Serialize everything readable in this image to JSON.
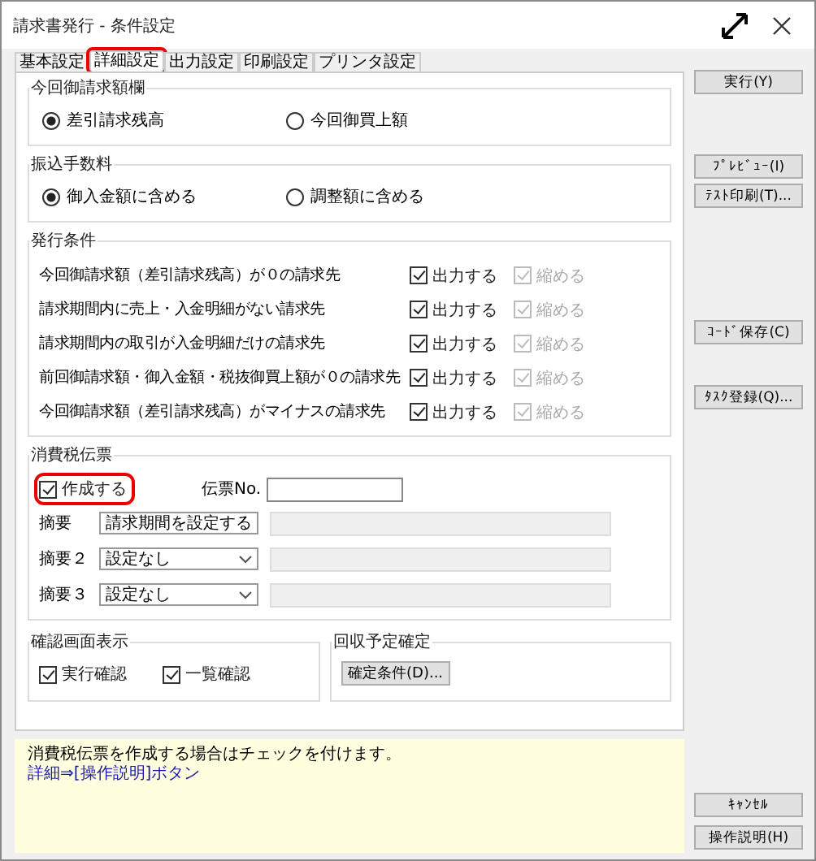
{
  "window": {
    "title": "請求書発行 - 条件設定"
  },
  "tabs": [
    {
      "label": "基本設定",
      "selected": false,
      "highlighted": false
    },
    {
      "label": "詳細設定",
      "selected": true,
      "highlighted": true
    },
    {
      "label": "出力設定",
      "selected": false,
      "highlighted": false
    },
    {
      "label": "印刷設定",
      "selected": false,
      "highlighted": false
    },
    {
      "label": "プリンタ設定",
      "selected": false,
      "highlighted": false
    }
  ],
  "billing_amount": {
    "title": "今回御請求額欄",
    "options": [
      {
        "label": "差引請求残高",
        "selected": true
      },
      {
        "label": "今回御買上額",
        "selected": false
      }
    ]
  },
  "transfer_fee": {
    "title": "振込手数料",
    "options": [
      {
        "label": "御入金額に含める",
        "selected": true
      },
      {
        "label": "調整額に含める",
        "selected": false
      }
    ]
  },
  "issue_conditions": {
    "title": "発行条件",
    "rows": [
      {
        "label": "今回御請求額（差引請求残高）が０の請求先",
        "output": {
          "label": "出力する",
          "checked": true,
          "disabled": false
        },
        "shrink": {
          "label": "縮める",
          "checked": true,
          "disabled": true
        }
      },
      {
        "label": "請求期間内に売上・入金明細がない請求先",
        "output": {
          "label": "出力する",
          "checked": true,
          "disabled": false
        },
        "shrink": {
          "label": "縮める",
          "checked": true,
          "disabled": true
        }
      },
      {
        "label": "請求期間内の取引が入金明細だけの請求先",
        "output": {
          "label": "出力する",
          "checked": true,
          "disabled": false
        },
        "shrink": {
          "label": "縮める",
          "checked": true,
          "disabled": true
        }
      },
      {
        "label": "前回御請求額・御入金額・税抜御買上額が０の請求先",
        "output": {
          "label": "出力する",
          "checked": true,
          "disabled": false
        },
        "shrink": {
          "label": "縮める",
          "checked": true,
          "disabled": true
        }
      },
      {
        "label": "今回御請求額（差引請求残高）がマイナスの請求先",
        "output": {
          "label": "出力する",
          "checked": true,
          "disabled": false
        },
        "shrink": {
          "label": "縮める",
          "checked": true,
          "disabled": true
        }
      }
    ]
  },
  "tax_slip": {
    "title": "消費税伝票",
    "create": {
      "label": "作成する",
      "checked": true,
      "highlighted": true
    },
    "slip_no_label": "伝票No.",
    "summaries": [
      {
        "label": "摘要",
        "value": "請求期間を設定する"
      },
      {
        "label": "摘要２",
        "value": "設定なし"
      },
      {
        "label": "摘要３",
        "value": "設定なし"
      }
    ]
  },
  "confirm_display": {
    "title": "確認画面表示",
    "checks": [
      {
        "label": "実行確認",
        "checked": true
      },
      {
        "label": "一覧確認",
        "checked": true
      }
    ]
  },
  "collection": {
    "title": "回収予定確定",
    "button": "確定条件(D)..."
  },
  "help": [
    {
      "kind": "text",
      "text": "消費税伝票を作成する場合はチェックを付けます。"
    },
    {
      "kind": "link",
      "text": "詳細⇒[操作説明]ボタン"
    }
  ],
  "buttons": [
    {
      "label": "実行(Y)"
    },
    {
      "label": "ﾌﾟﾚﾋﾞｭｰ(I)"
    },
    {
      "label": "ﾃｽﾄ印刷(T)..."
    },
    {
      "label": "ｺｰﾄﾞ保存(C)"
    },
    {
      "label": "ﾀｽｸ登録(Q)..."
    },
    {
      "label": "ｷｬﾝｾﾙ"
    },
    {
      "label": "操作説明(H)"
    }
  ]
}
